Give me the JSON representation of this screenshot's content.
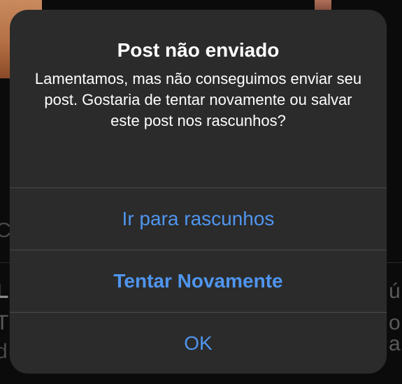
{
  "alert": {
    "title": "Post não enviado",
    "message": "Lamentamos, mas não conseguimos enviar seu post. Gostaria de tentar novamente ou salvar este post nos rascunhos?",
    "buttons": [
      {
        "label": "Ir para rascunhos",
        "style": "default"
      },
      {
        "label": "Tentar Novamente",
        "style": "preferred"
      },
      {
        "label": "OK",
        "style": "default"
      }
    ]
  },
  "background": {
    "partial_text": [
      "C",
      "L",
      "T",
      "d",
      "ú",
      "o a"
    ]
  },
  "colors": {
    "alert_background": "#2b2b2b",
    "button_text": "#4f95ee",
    "separator": "#4b4b4b",
    "title_text": "#ffffff"
  }
}
